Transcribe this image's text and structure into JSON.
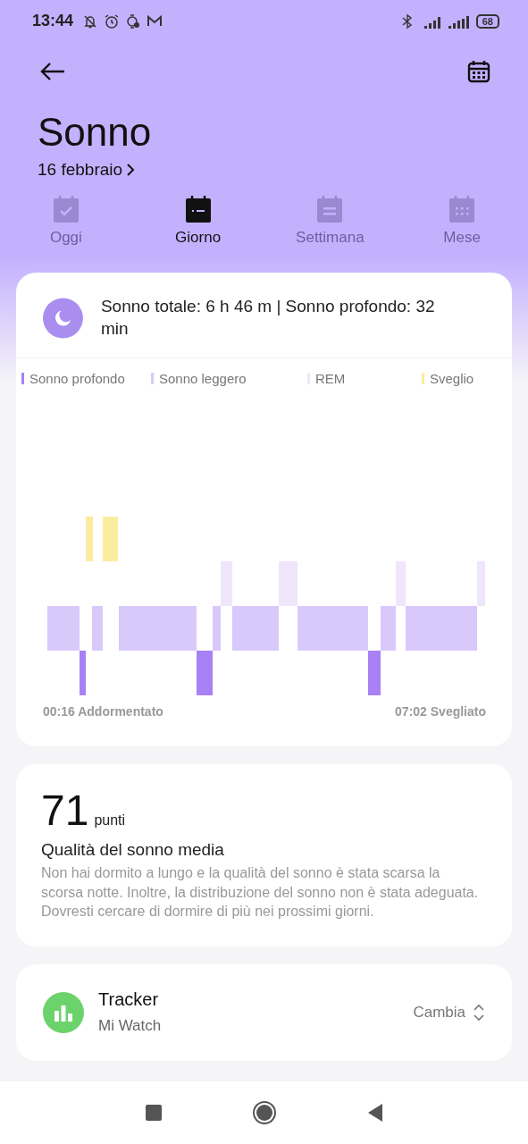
{
  "status_bar": {
    "time": "13:44",
    "battery": "68"
  },
  "header": {
    "title": "Sonno",
    "date": "16 febbraio"
  },
  "tabs": [
    {
      "label": "Oggi",
      "selected": false,
      "kind": "today"
    },
    {
      "label": "Giorno",
      "selected": true,
      "kind": "day"
    },
    {
      "label": "Settimana",
      "selected": false,
      "kind": "week"
    },
    {
      "label": "Mese",
      "selected": false,
      "kind": "month"
    }
  ],
  "sleep_card": {
    "summary": "Sonno totale: 6 h 46 m | Sonno profondo: 32 min",
    "legend": [
      {
        "label": "Sonno profondo",
        "color": "#a881f5"
      },
      {
        "label": "Sonno leggero",
        "color": "#d9c9fb"
      },
      {
        "label": "REM",
        "color": "#efe6fc"
      },
      {
        "label": "Sveglio",
        "color": "#fbeca0"
      }
    ],
    "start": "00:16 Addormentato",
    "end": "07:02 Svegliato"
  },
  "score_card": {
    "score": "71",
    "unit": "punti",
    "title": "Qualità del sonno media",
    "description": "Non hai dormito a lungo e la qualità del sonno è stata scarsa la scorsa notte. Inoltre, la distribuzione del sonno non è stata adeguata. Dovresti cercare di dormire di più nei prossimi giorni."
  },
  "device_card": {
    "title": "Tracker",
    "device": "Mi Watch",
    "action": "Cambia"
  }
}
